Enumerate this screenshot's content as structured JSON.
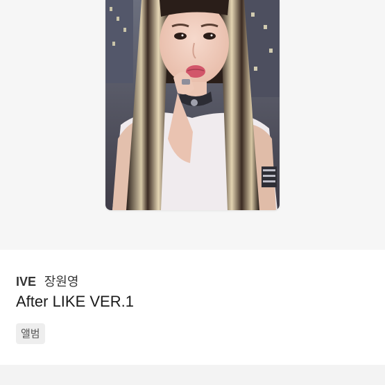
{
  "photocard": {
    "image_alt": "photocard image"
  },
  "info": {
    "group": "IVE",
    "member": "장원영",
    "title": "After LIKE VER.1",
    "tag": "앨범"
  }
}
